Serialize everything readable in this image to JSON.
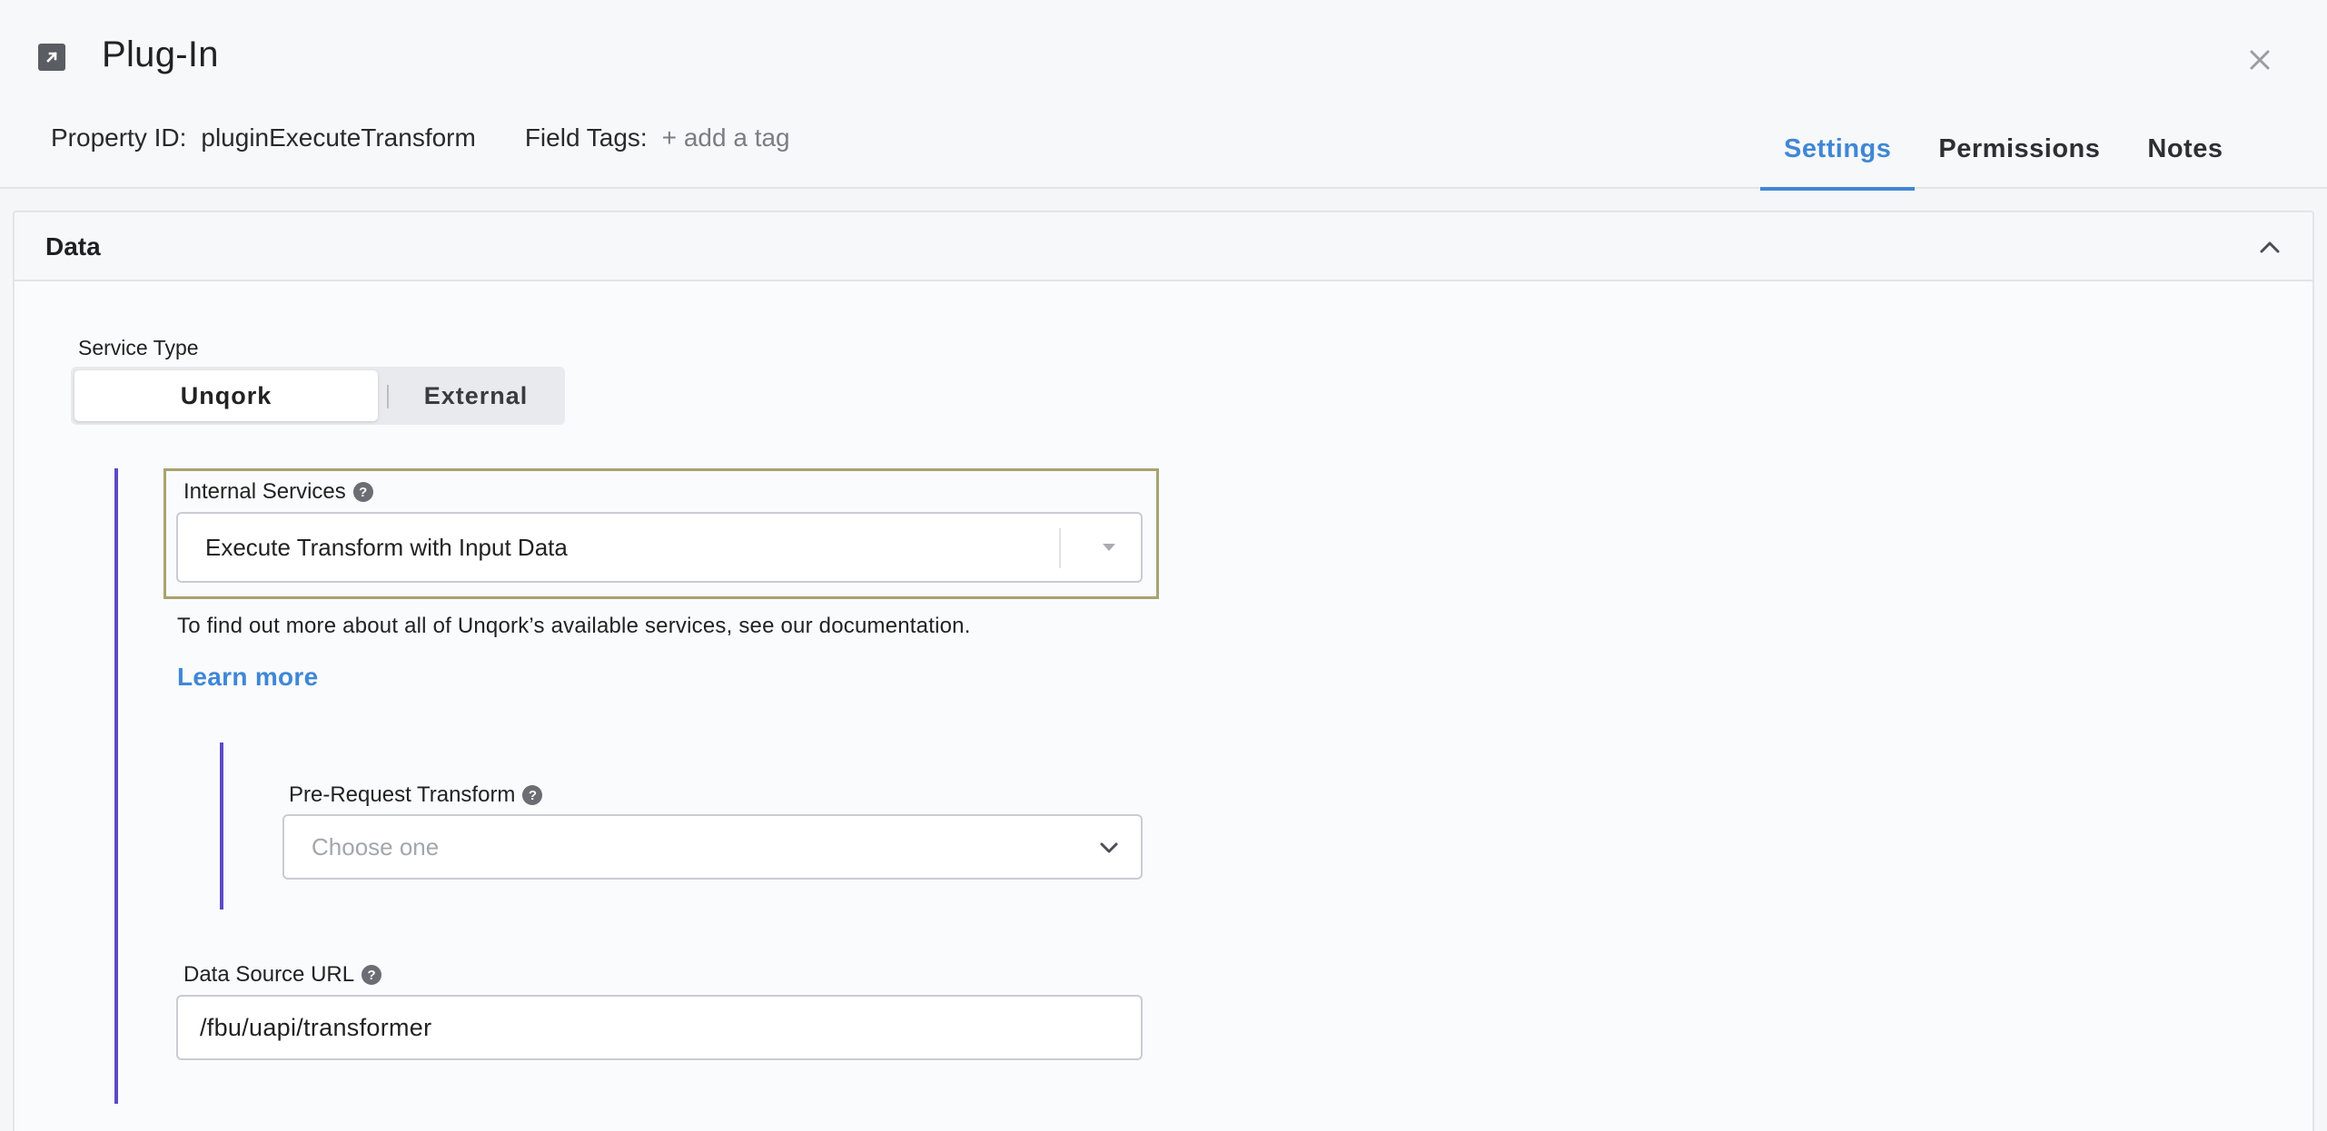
{
  "header": {
    "title": "Plug-In",
    "property_id_label": "Property ID:",
    "property_id_value": "pluginExecuteTransform",
    "field_tags_label": "Field Tags:",
    "add_tag_label": "+ add a tag",
    "tabs": [
      {
        "label": "Settings",
        "active": true
      },
      {
        "label": "Permissions",
        "active": false
      },
      {
        "label": "Notes",
        "active": false
      }
    ]
  },
  "panel": {
    "title": "Data",
    "service_type": {
      "label": "Service Type",
      "options": [
        "Unqork",
        "External"
      ],
      "selected": "Unqork"
    },
    "internal_services": {
      "label": "Internal Services",
      "value": "Execute Transform with Input Data"
    },
    "helper_text": "To find out more about all of Unqork’s available services, see our documentation.",
    "learn_more": "Learn more",
    "pre_request": {
      "label": "Pre-Request Transform",
      "placeholder": "Choose one"
    },
    "data_source_url": {
      "label": "Data Source URL",
      "value": "/fbu/uapi/transformer"
    }
  },
  "colors": {
    "accent": "#3f87d6",
    "nest_bar": "#5b4bc4",
    "highlight_border": "#a8a271"
  }
}
